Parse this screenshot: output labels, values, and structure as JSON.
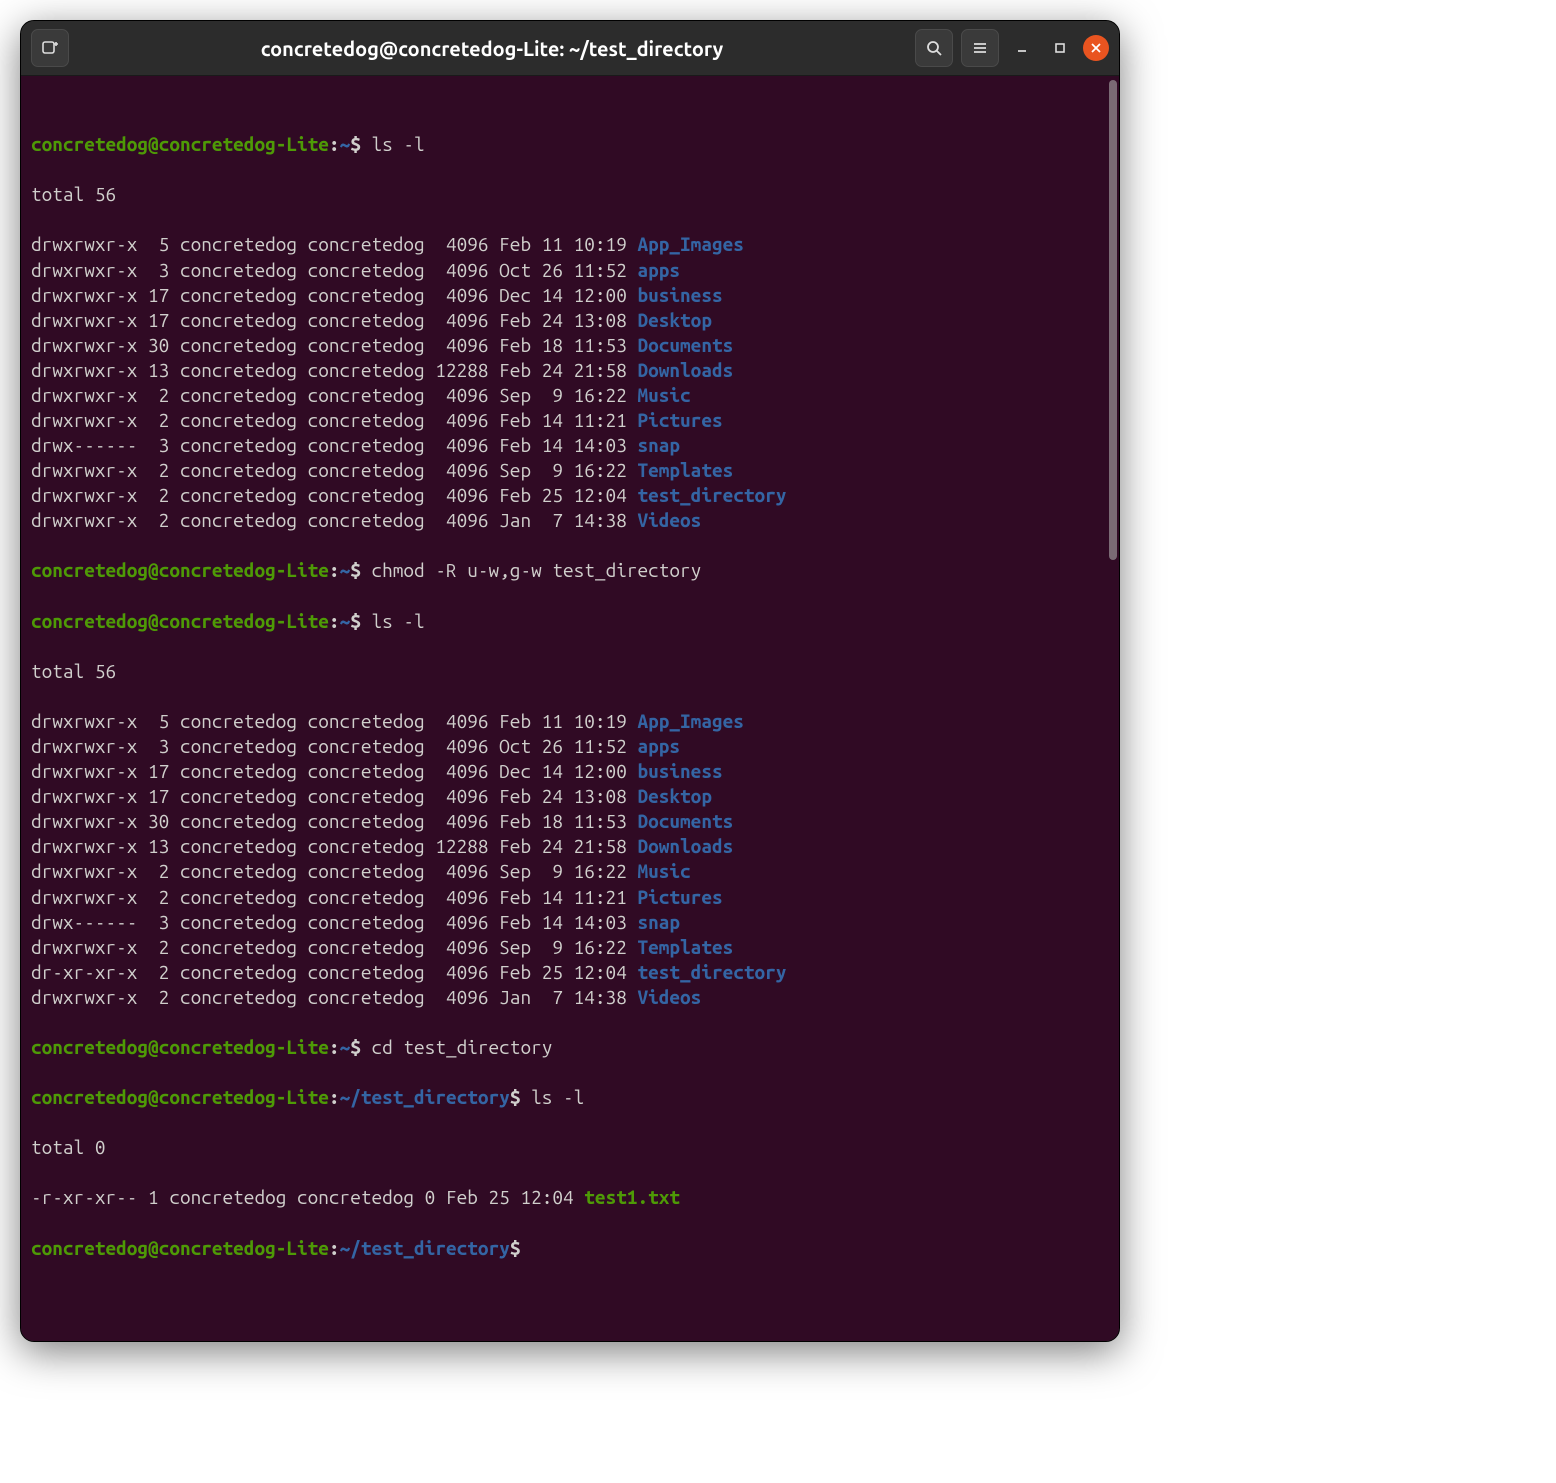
{
  "window": {
    "title": "concretedog@concretedog-Lite: ~/test_directory"
  },
  "prompt": {
    "user_host": "concretedog@concretedog-Lite",
    "sep": ":",
    "home": "~",
    "testdir": "~/test_directory",
    "dollar": "$"
  },
  "cmds": {
    "ls_l": "ls -l",
    "chmod": "chmod -R u-w,g-w test_directory",
    "cd": "cd test_directory"
  },
  "totals": {
    "t56": "total 56",
    "t0": "total 0"
  },
  "ls1": [
    {
      "perm": "drwxrwxr-x",
      "links": " 5",
      "owner": "concretedog",
      "group": "concretedog",
      "size": " 4096",
      "date": "Feb 11 10:19",
      "name": "App_Images",
      "cls": "dir"
    },
    {
      "perm": "drwxrwxr-x",
      "links": " 3",
      "owner": "concretedog",
      "group": "concretedog",
      "size": " 4096",
      "date": "Oct 26 11:52",
      "name": "apps",
      "cls": "dir"
    },
    {
      "perm": "drwxrwxr-x",
      "links": "17",
      "owner": "concretedog",
      "group": "concretedog",
      "size": " 4096",
      "date": "Dec 14 12:00",
      "name": "business",
      "cls": "dir"
    },
    {
      "perm": "drwxrwxr-x",
      "links": "17",
      "owner": "concretedog",
      "group": "concretedog",
      "size": " 4096",
      "date": "Feb 24 13:08",
      "name": "Desktop",
      "cls": "dir"
    },
    {
      "perm": "drwxrwxr-x",
      "links": "30",
      "owner": "concretedog",
      "group": "concretedog",
      "size": " 4096",
      "date": "Feb 18 11:53",
      "name": "Documents",
      "cls": "dir"
    },
    {
      "perm": "drwxrwxr-x",
      "links": "13",
      "owner": "concretedog",
      "group": "concretedog",
      "size": "12288",
      "date": "Feb 24 21:58",
      "name": "Downloads",
      "cls": "dir"
    },
    {
      "perm": "drwxrwxr-x",
      "links": " 2",
      "owner": "concretedog",
      "group": "concretedog",
      "size": " 4096",
      "date": "Sep  9 16:22",
      "name": "Music",
      "cls": "dir"
    },
    {
      "perm": "drwxrwxr-x",
      "links": " 2",
      "owner": "concretedog",
      "group": "concretedog",
      "size": " 4096",
      "date": "Feb 14 11:21",
      "name": "Pictures",
      "cls": "dir"
    },
    {
      "perm": "drwx------",
      "links": " 3",
      "owner": "concretedog",
      "group": "concretedog",
      "size": " 4096",
      "date": "Feb 14 14:03",
      "name": "snap",
      "cls": "dir"
    },
    {
      "perm": "drwxrwxr-x",
      "links": " 2",
      "owner": "concretedog",
      "group": "concretedog",
      "size": " 4096",
      "date": "Sep  9 16:22",
      "name": "Templates",
      "cls": "dir"
    },
    {
      "perm": "drwxrwxr-x",
      "links": " 2",
      "owner": "concretedog",
      "group": "concretedog",
      "size": " 4096",
      "date": "Feb 25 12:04",
      "name": "test_directory",
      "cls": "dir"
    },
    {
      "perm": "drwxrwxr-x",
      "links": " 2",
      "owner": "concretedog",
      "group": "concretedog",
      "size": " 4096",
      "date": "Jan  7 14:38",
      "name": "Videos",
      "cls": "dir"
    }
  ],
  "ls2": [
    {
      "perm": "drwxrwxr-x",
      "links": " 5",
      "owner": "concretedog",
      "group": "concretedog",
      "size": " 4096",
      "date": "Feb 11 10:19",
      "name": "App_Images",
      "cls": "dir"
    },
    {
      "perm": "drwxrwxr-x",
      "links": " 3",
      "owner": "concretedog",
      "group": "concretedog",
      "size": " 4096",
      "date": "Oct 26 11:52",
      "name": "apps",
      "cls": "dir"
    },
    {
      "perm": "drwxrwxr-x",
      "links": "17",
      "owner": "concretedog",
      "group": "concretedog",
      "size": " 4096",
      "date": "Dec 14 12:00",
      "name": "business",
      "cls": "dir"
    },
    {
      "perm": "drwxrwxr-x",
      "links": "17",
      "owner": "concretedog",
      "group": "concretedog",
      "size": " 4096",
      "date": "Feb 24 13:08",
      "name": "Desktop",
      "cls": "dir"
    },
    {
      "perm": "drwxrwxr-x",
      "links": "30",
      "owner": "concretedog",
      "group": "concretedog",
      "size": " 4096",
      "date": "Feb 18 11:53",
      "name": "Documents",
      "cls": "dir"
    },
    {
      "perm": "drwxrwxr-x",
      "links": "13",
      "owner": "concretedog",
      "group": "concretedog",
      "size": "12288",
      "date": "Feb 24 21:58",
      "name": "Downloads",
      "cls": "dir"
    },
    {
      "perm": "drwxrwxr-x",
      "links": " 2",
      "owner": "concretedog",
      "group": "concretedog",
      "size": " 4096",
      "date": "Sep  9 16:22",
      "name": "Music",
      "cls": "dir"
    },
    {
      "perm": "drwxrwxr-x",
      "links": " 2",
      "owner": "concretedog",
      "group": "concretedog",
      "size": " 4096",
      "date": "Feb 14 11:21",
      "name": "Pictures",
      "cls": "dir"
    },
    {
      "perm": "drwx------",
      "links": " 3",
      "owner": "concretedog",
      "group": "concretedog",
      "size": " 4096",
      "date": "Feb 14 14:03",
      "name": "snap",
      "cls": "dir"
    },
    {
      "perm": "drwxrwxr-x",
      "links": " 2",
      "owner": "concretedog",
      "group": "concretedog",
      "size": " 4096",
      "date": "Sep  9 16:22",
      "name": "Templates",
      "cls": "dir"
    },
    {
      "perm": "dr-xr-xr-x",
      "links": " 2",
      "owner": "concretedog",
      "group": "concretedog",
      "size": " 4096",
      "date": "Feb 25 12:04",
      "name": "test_directory",
      "cls": "dir"
    },
    {
      "perm": "drwxrwxr-x",
      "links": " 2",
      "owner": "concretedog",
      "group": "concretedog",
      "size": " 4096",
      "date": "Jan  7 14:38",
      "name": "Videos",
      "cls": "dir"
    }
  ],
  "ls3": [
    {
      "perm": "-r-xr-xr--",
      "links": "1",
      "owner": "concretedog",
      "group": "concretedog",
      "size": "0",
      "date": "Feb 25 12:04",
      "name": "test1.txt",
      "cls": "file-exec"
    }
  ]
}
